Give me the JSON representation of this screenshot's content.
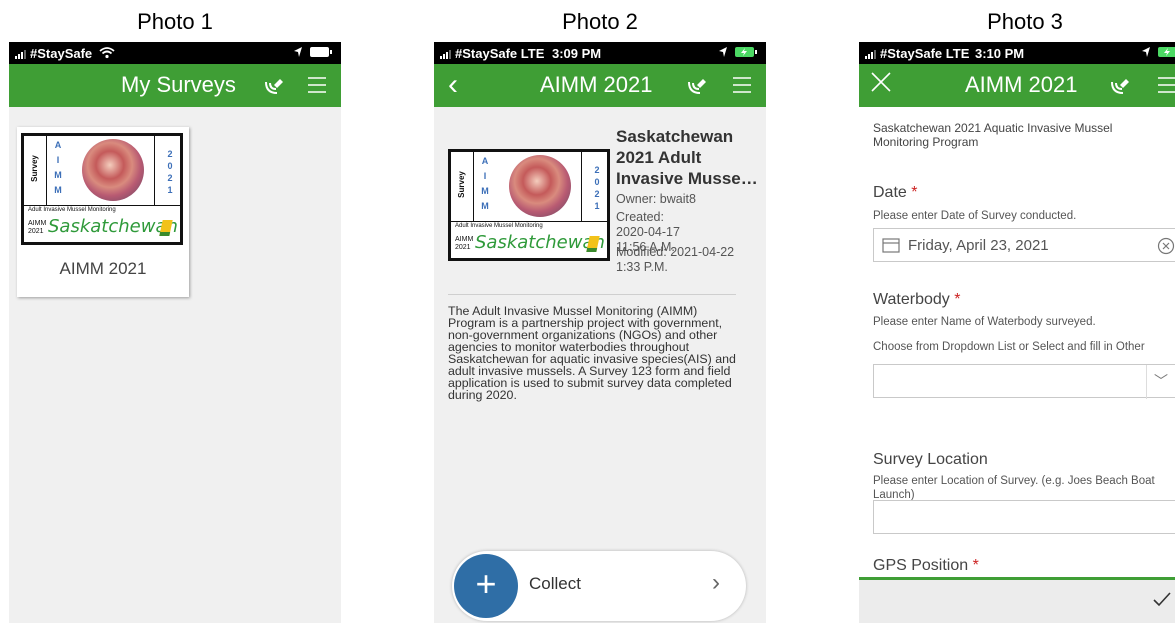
{
  "captions": [
    "Photo 1",
    "Photo 2",
    "Photo 3"
  ],
  "status": {
    "carrier": "#StaySafe",
    "network": "LTE",
    "time_photo2": "3:09 PM",
    "time_photo3": "3:10 PM"
  },
  "logo": {
    "vertical_label": "Survey",
    "aimm_letters": "A I M M",
    "year_digits": "2 0 2 1",
    "subtitle": "Adult Invasive Mussel Monitoring",
    "small_lines": "AIMM 2021",
    "brand": "Saskatchewan"
  },
  "photo1": {
    "title": "My Surveys",
    "survey_card_label": "AIMM 2021"
  },
  "photo2": {
    "title": "AIMM 2021",
    "survey_title": "Saskatchewan 2021 Adult Invasive Musse…",
    "owner": "Owner: bwait8",
    "created": "Created: 2020-04-17 11:56 A.M.",
    "modified": "Modified: 2021-04-22 1:33 P.M.",
    "description": "The Adult Invasive Mussel Monitoring (AIMM) Program is a partnership project with government, non-government organizations (NGOs) and other agencies to monitor waterbodies throughout Saskatchewan for aquatic invasive species(AIS) and adult invasive mussels. A Survey 123 form and field application is used to submit survey data completed during 2020.",
    "collect_label": "Collect"
  },
  "photo3": {
    "title": "AIMM 2021",
    "intro": "Saskatchewan 2021 Aquatic Invasive Mussel Monitoring Program",
    "date_label": "Date",
    "date_hint": "Please enter Date of Survey conducted.",
    "date_value": "Friday, April 23, 2021",
    "waterbody_label": "Waterbody",
    "waterbody_hint": "Please enter Name of Waterbody surveyed.",
    "waterbody_hint2": "Choose from Dropdown List or Select and fill in Other",
    "location_label": "Survey Location",
    "location_hint": "Please enter Location of Survey. (e.g. Joes Beach Boat Launch)",
    "gps_label": "GPS Position",
    "required_mark": "*"
  },
  "colors": {
    "header_green": "#3f9e35",
    "collect_blue": "#2f6ea6",
    "required_red": "#cc2222"
  }
}
